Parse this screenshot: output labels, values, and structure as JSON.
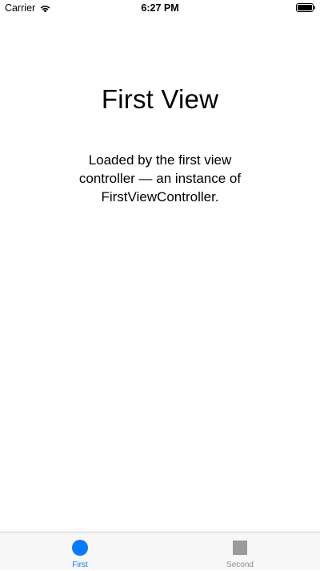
{
  "status_bar": {
    "carrier": "Carrier",
    "time": "6:27 PM",
    "wifi_icon": "wifi-icon",
    "battery_icon": "battery-icon"
  },
  "main": {
    "title": "First View",
    "message": "Loaded by the first view controller — an instance of FirstViewController."
  },
  "tab_bar": {
    "tabs": [
      {
        "label": "First",
        "icon": "circle-icon",
        "selected": true
      },
      {
        "label": "Second",
        "icon": "square-icon",
        "selected": false
      }
    ]
  },
  "colors": {
    "accent": "#0A7AFF",
    "inactive_tab": "#8E8E8E",
    "tab_bar_background": "#F7F7F7"
  }
}
